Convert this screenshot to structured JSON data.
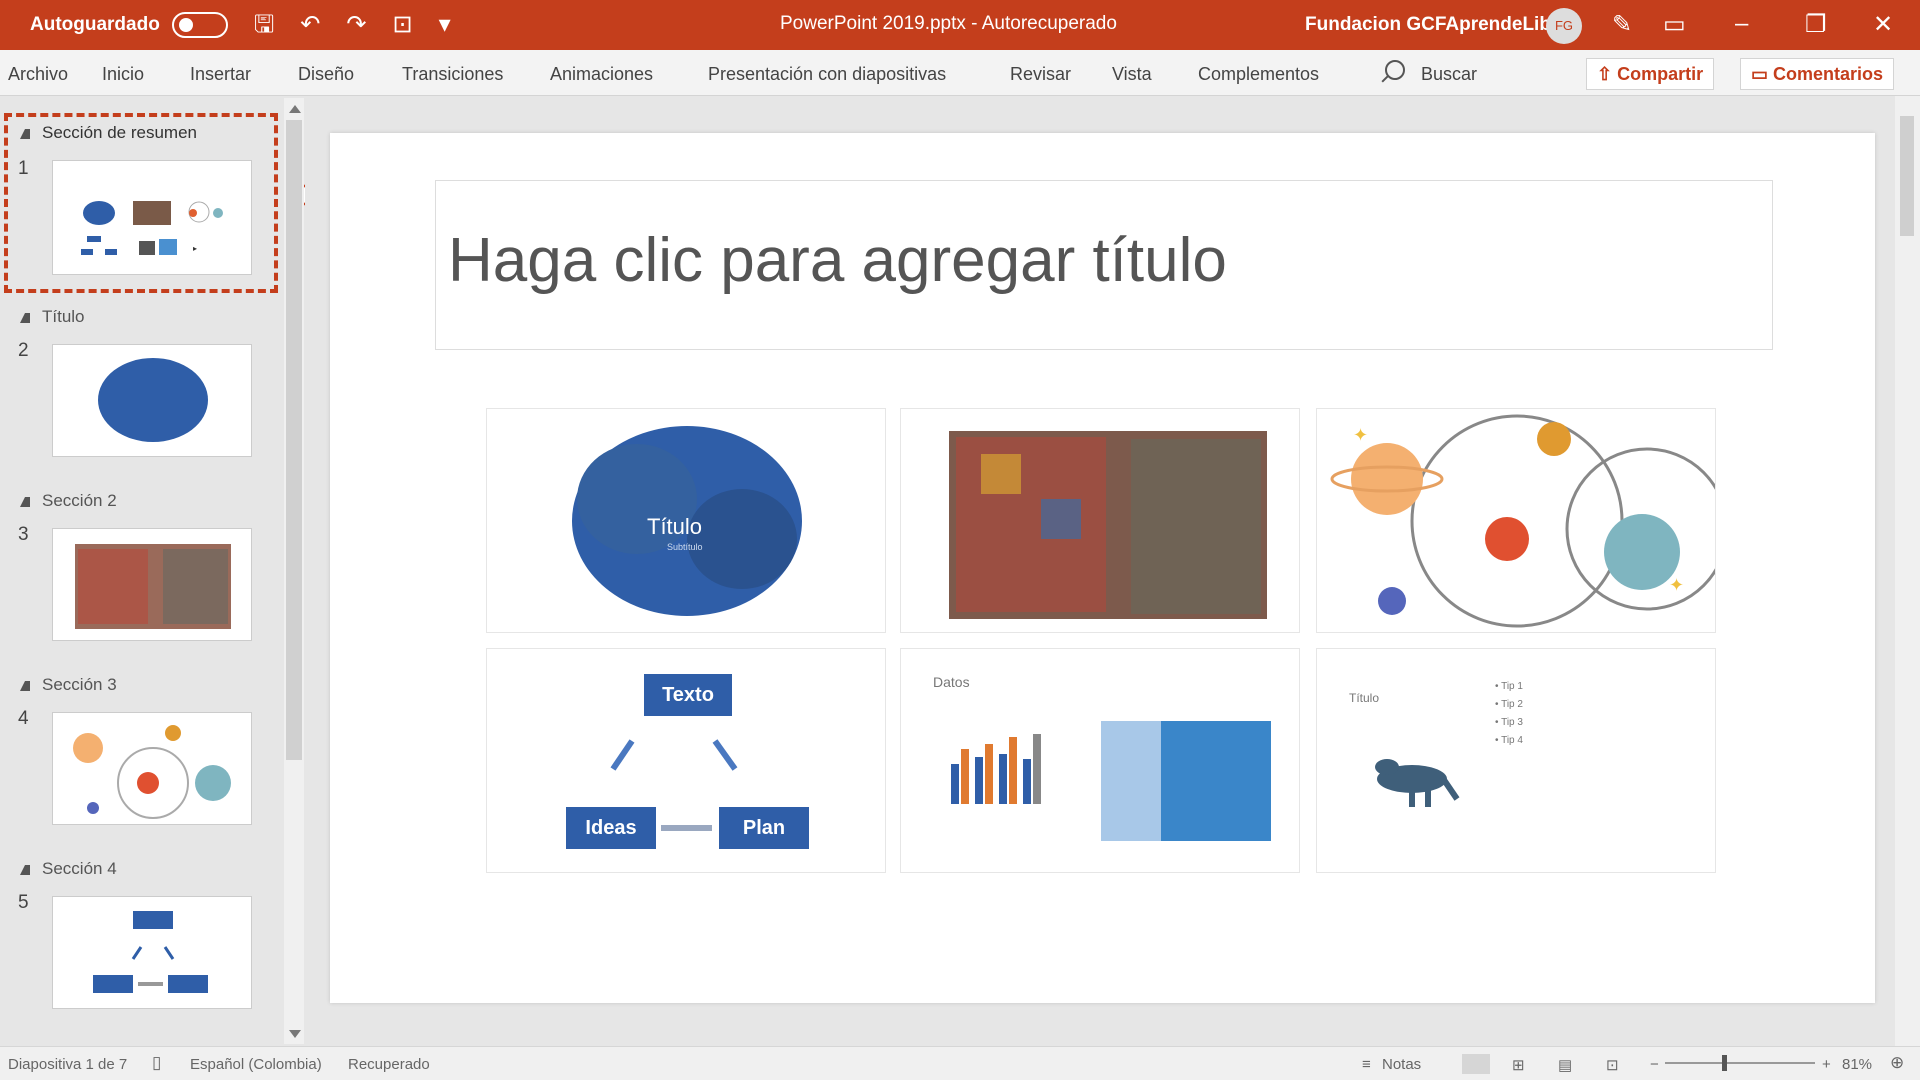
{
  "titlebar": {
    "autosave_label": "Autoguardado",
    "document_title": "PowerPoint 2019.pptx - Autorecuperado",
    "user_name": "Fundacion GCFAprendeLibre",
    "avatar_initials": "FG"
  },
  "ribbon": {
    "tabs": [
      "Archivo",
      "Inicio",
      "Insertar",
      "Diseño",
      "Transiciones",
      "Animaciones",
      "Presentación con diapositivas",
      "Revisar",
      "Vista",
      "Complementos"
    ],
    "search_label": "Buscar",
    "share_label": "Compartir",
    "comments_label": "Comentarios"
  },
  "panel": {
    "sections": [
      {
        "name": "Sección de resumen",
        "slide": "1"
      },
      {
        "name": "Título",
        "slide": "2"
      },
      {
        "name": "Sección 2",
        "slide": "3"
      },
      {
        "name": "Sección 3",
        "slide": "4"
      },
      {
        "name": "Sección 4",
        "slide": "5"
      }
    ]
  },
  "slide": {
    "title_placeholder": "Haga clic para agregar título",
    "cards": {
      "cloud_title": "Título",
      "cloud_sub": "Subtítulo",
      "diagram": {
        "top": "Texto",
        "left": "Ideas",
        "right": "Plan"
      },
      "data_label": "Datos",
      "list_title": "Título",
      "list_items": [
        "• Tip 1",
        "• Tip 2",
        "• Tip 3",
        "• Tip 4"
      ]
    }
  },
  "statusbar": {
    "slide_count": "Diapositiva 1 de 7",
    "language": "Español (Colombia)",
    "recovered": "Recuperado",
    "notes": "Notas",
    "zoom": "81%"
  },
  "colors": {
    "accent": "#c43e1c",
    "diagram_blue": "#2f5ea8"
  }
}
